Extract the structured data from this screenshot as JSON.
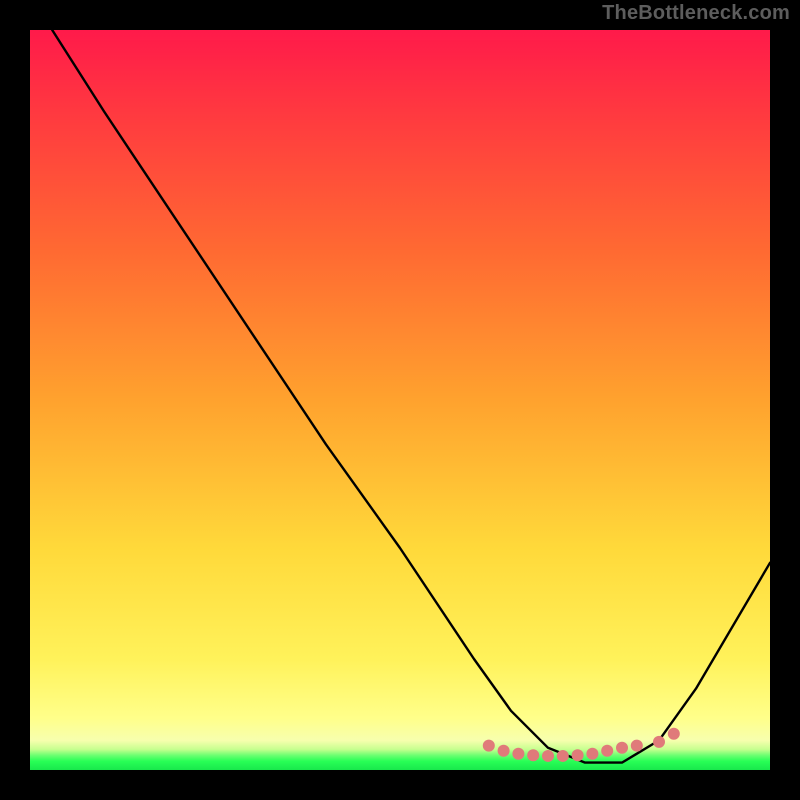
{
  "watermark": "TheBottleneck.com",
  "chart_data": {
    "type": "line",
    "title": "",
    "xlabel": "",
    "ylabel": "",
    "xlim": [
      0,
      100
    ],
    "ylim": [
      0,
      100
    ],
    "background_gradient": {
      "top": "#ff1a4a",
      "mid": "#ffd23f",
      "bottom_band": "#ffff8a",
      "green_thin": "#29ff56"
    },
    "series": [
      {
        "name": "curve",
        "x": [
          3,
          10,
          20,
          30,
          40,
          50,
          60,
          65,
          70,
          75,
          80,
          85,
          90,
          100
        ],
        "y": [
          100,
          89,
          74,
          59,
          44,
          30,
          15,
          8,
          3,
          1,
          1,
          4,
          11,
          28
        ]
      }
    ],
    "annotations": {
      "bottom_dots_color": "#e07a7a",
      "bottom_dots_x": [
        62,
        64,
        66,
        68,
        70,
        72,
        74,
        76,
        78,
        80,
        82,
        85,
        87
      ],
      "bottom_dots_y": [
        3.3,
        2.6,
        2.2,
        2.0,
        1.9,
        1.9,
        2.0,
        2.2,
        2.6,
        3.0,
        3.3,
        3.8,
        4.9
      ]
    }
  }
}
